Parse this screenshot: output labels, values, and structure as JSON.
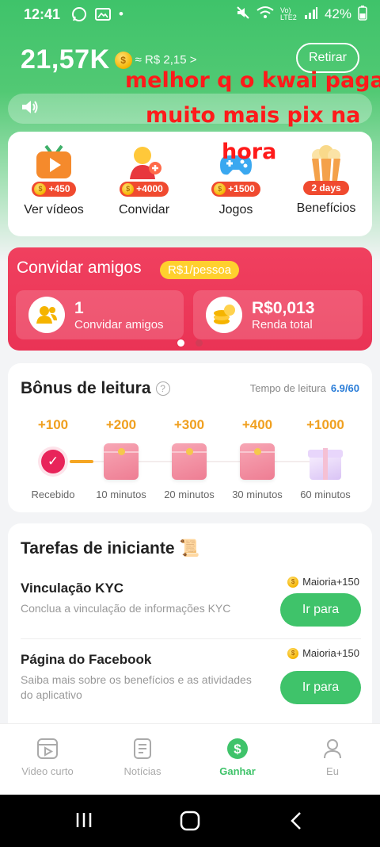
{
  "status_bar": {
    "time": "12:41",
    "battery": "42%",
    "network": "Vo) LTE2"
  },
  "header": {
    "balance": "21,57K",
    "approx": "≈ R$ 2,15 >",
    "withdraw_label": "Retirar"
  },
  "overlay": {
    "line1": "melhor q o kwai paga",
    "line2": "muito mais pix na",
    "line3": "hora"
  },
  "quick_actions": [
    {
      "label": "Ver vídeos",
      "badge": "+450",
      "icon": "video-icon"
    },
    {
      "label": "Convidar",
      "badge": "+4000",
      "icon": "invite-person-icon"
    },
    {
      "label": "Jogos",
      "badge": "+1500",
      "icon": "gamepad-icon"
    },
    {
      "label": "Benefícios",
      "badge": "2 days",
      "icon": "popcorn-icon"
    }
  ],
  "invite": {
    "title": "Convidar amigos",
    "pill": "R$1/pessoa",
    "count": "1",
    "count_label": "Convidar amigos",
    "income": "R$0,013",
    "income_label": "Renda total"
  },
  "reading": {
    "title": "Bônus de leitura",
    "time_label": "Tempo de leitura",
    "time_value": "6.9/60",
    "rewards": [
      {
        "points": "+100",
        "caption": "Recebido"
      },
      {
        "points": "+200",
        "caption": "10 minutos"
      },
      {
        "points": "+300",
        "caption": "20 minutos"
      },
      {
        "points": "+400",
        "caption": "30 minutos"
      },
      {
        "points": "+1000",
        "caption": "60 minutos"
      }
    ]
  },
  "tasks": {
    "title": "Tarefas de iniciante",
    "items": [
      {
        "name": "Vinculação KYC",
        "desc": "Conclua a vinculação de informações KYC",
        "reward": "Maioria+150",
        "button": "Ir para"
      },
      {
        "name": "Página do Facebook",
        "desc": "Saiba mais sobre os benefícios e as atividades do aplicativo",
        "reward": "Maioria+150",
        "button": "Ir para"
      }
    ]
  },
  "bottom_nav": [
    {
      "label": "Video curto",
      "icon": "video-play-icon"
    },
    {
      "label": "Notícias",
      "icon": "news-icon"
    },
    {
      "label": "Ganhar",
      "icon": "dollar-icon",
      "active": true
    },
    {
      "label": "Eu",
      "icon": "user-icon"
    }
  ],
  "colors": {
    "primary_green": "#3fc36a",
    "invite_red": "#ea3355",
    "overlay_red": "#ff1a1a",
    "reward_orange": "#f0a020"
  }
}
